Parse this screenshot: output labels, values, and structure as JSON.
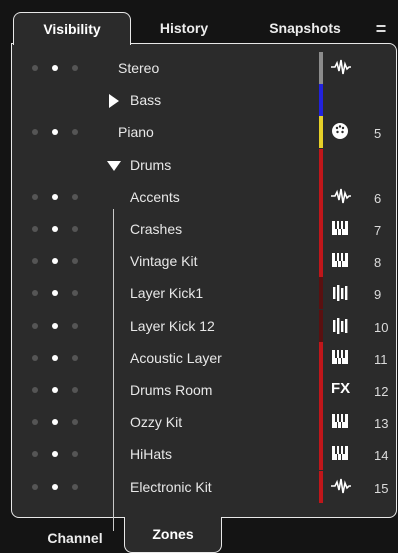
{
  "tabs": {
    "visibility": "Visibility",
    "history": "History",
    "snapshots": "Snapshots",
    "menu": "="
  },
  "tracks": [
    {
      "name": "Stereo",
      "number": "",
      "dots": [
        false,
        true,
        false
      ],
      "color": "#8c8c8c",
      "icon": "waveform-icon",
      "level": 0
    },
    {
      "name": "Bass",
      "number": "",
      "dots": null,
      "color": "#2222dd",
      "icon": "",
      "level": 1,
      "expander": "collapsed"
    },
    {
      "name": "Piano",
      "number": "5",
      "dots": [
        false,
        true,
        false
      ],
      "color": "#e6d028",
      "icon": "midi-port-icon",
      "level": 0
    },
    {
      "name": "Drums",
      "number": "",
      "dots": null,
      "color": "#c0161a",
      "icon": "",
      "level": 1,
      "expander": "expanded"
    },
    {
      "name": "Accents",
      "number": "6",
      "dots": [
        false,
        true,
        false
      ],
      "color": "#c0161a",
      "icon": "waveform-icon",
      "level": 1
    },
    {
      "name": "Crashes",
      "number": "7",
      "dots": [
        false,
        true,
        false
      ],
      "color": "#c0161a",
      "icon": "instrument-icon",
      "level": 1
    },
    {
      "name": "Vintage Kit",
      "number": "8",
      "dots": [
        false,
        true,
        false
      ],
      "color": "#c0161a",
      "icon": "instrument-icon",
      "level": 1
    },
    {
      "name": "Layer Kick1",
      "number": "9",
      "dots": [
        false,
        true,
        false
      ],
      "color": "#5a1010",
      "icon": "midi-icon",
      "level": 1
    },
    {
      "name": "Layer Kick 12",
      "number": "10",
      "dots": [
        false,
        true,
        false
      ],
      "color": "#5a1010",
      "icon": "midi-icon",
      "level": 1
    },
    {
      "name": "Acoustic Layer",
      "number": "11",
      "dots": [
        false,
        true,
        false
      ],
      "color": "#c0161a",
      "icon": "instrument-icon",
      "level": 1
    },
    {
      "name": "Drums Room",
      "number": "12",
      "dots": [
        false,
        true,
        false
      ],
      "color": "#c0161a",
      "icon": "fx-icon",
      "level": 1
    },
    {
      "name": "Ozzy Kit",
      "number": "13",
      "dots": [
        false,
        true,
        false
      ],
      "color": "#c0161a",
      "icon": "instrument-icon",
      "level": 1
    },
    {
      "name": "HiHats",
      "number": "14",
      "dots": [
        false,
        true,
        false
      ],
      "color": "#c0161a",
      "icon": "instrument-icon",
      "level": 1
    },
    {
      "name": "Electronic Kit",
      "number": "15",
      "dots": [
        false,
        true,
        false
      ],
      "color": "#c0161a",
      "icon": "waveform-icon",
      "level": 1
    }
  ],
  "fx_label": "FX",
  "bottom_tabs": {
    "channel": "Channel",
    "zones": "Zones"
  }
}
